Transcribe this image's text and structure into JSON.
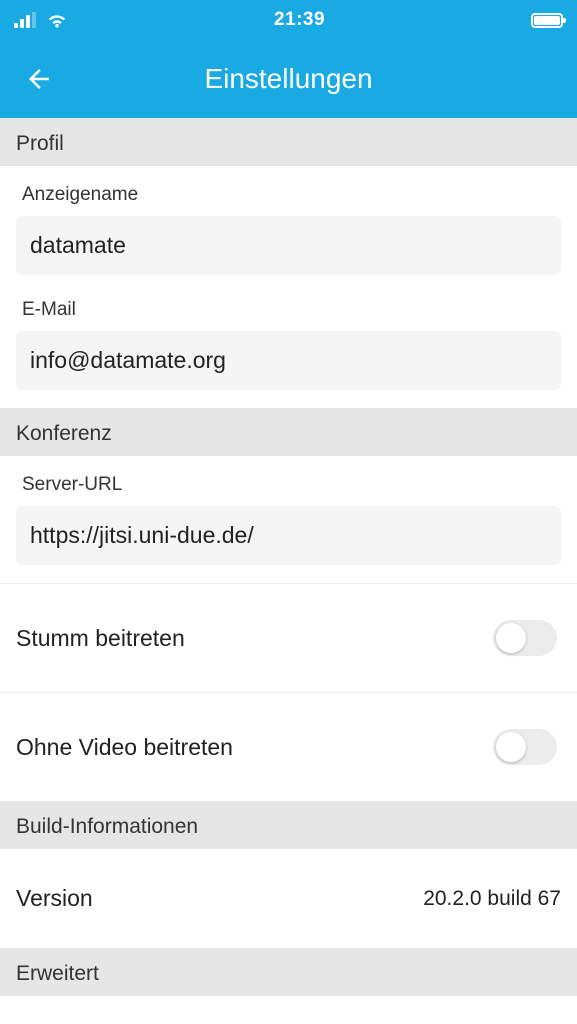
{
  "status": {
    "time": "21:39"
  },
  "header": {
    "title": "Einstellungen"
  },
  "sections": {
    "profile": {
      "title": "Profil",
      "display_name_label": "Anzeigename",
      "display_name_value": "datamate",
      "email_label": "E-Mail",
      "email_value": "info@datamate.org"
    },
    "conference": {
      "title": "Konferenz",
      "server_url_label": "Server-URL",
      "server_url_value": "https://jitsi.uni-due.de/",
      "mute_label": "Stumm beitreten",
      "mute_on": false,
      "novideo_label": "Ohne Video beitreten",
      "novideo_on": false
    },
    "build": {
      "title": "Build-Informationen",
      "version_label": "Version",
      "version_value": "20.2.0 build 67"
    },
    "advanced": {
      "title": "Erweitert"
    }
  }
}
